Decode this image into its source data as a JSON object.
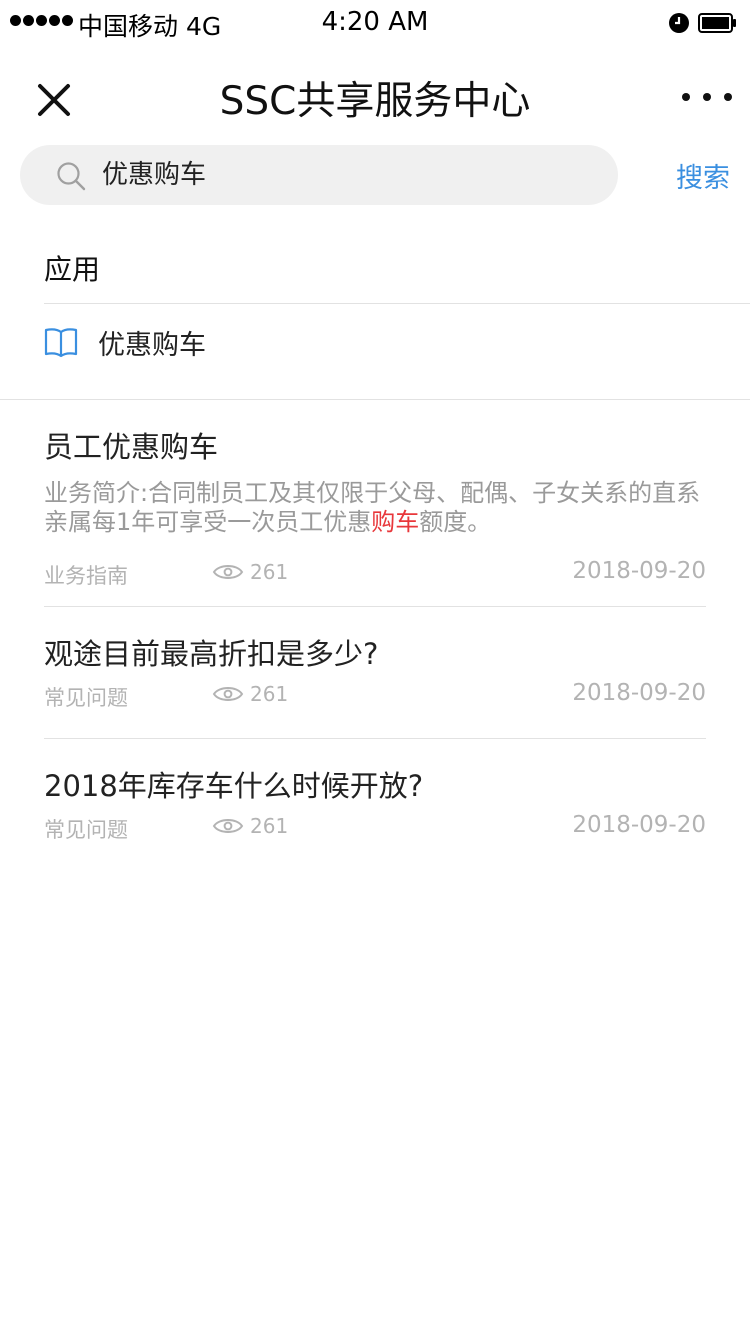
{
  "status_bar": {
    "carrier": "中国移动",
    "network": "4G",
    "time": "4:20 AM"
  },
  "nav": {
    "title": "SSC共享服务中心",
    "close_icon": "close-icon",
    "more_icon": "more-icon"
  },
  "search": {
    "value": "优惠购车",
    "button_label": "搜索",
    "icon": "search-icon"
  },
  "apps": {
    "section_title": "应用",
    "items": [
      {
        "label": "优惠购车",
        "icon": "book-icon"
      }
    ]
  },
  "results": [
    {
      "title": "员工优惠购车",
      "desc_before": "业务简介:合同制员工及其仅限于父母、配偶、子女关系的直系亲属每1年可享受一次员工优惠",
      "desc_highlight": "购车",
      "desc_after": "额度。",
      "category": "业务指南",
      "views": "261",
      "date": "2018-09-20"
    },
    {
      "title": "观途目前最高折扣是多少?",
      "category": "常见问题",
      "views": "261",
      "date": "2018-09-20"
    },
    {
      "title": "2018年库存车什么时候开放?",
      "category": "常见问题",
      "views": "261",
      "date": "2018-09-20"
    }
  ],
  "colors": {
    "accent": "#3a8fe0",
    "highlight": "#e8373b",
    "muted": "#b3b3b3",
    "search_bg": "#f0f0f0"
  }
}
